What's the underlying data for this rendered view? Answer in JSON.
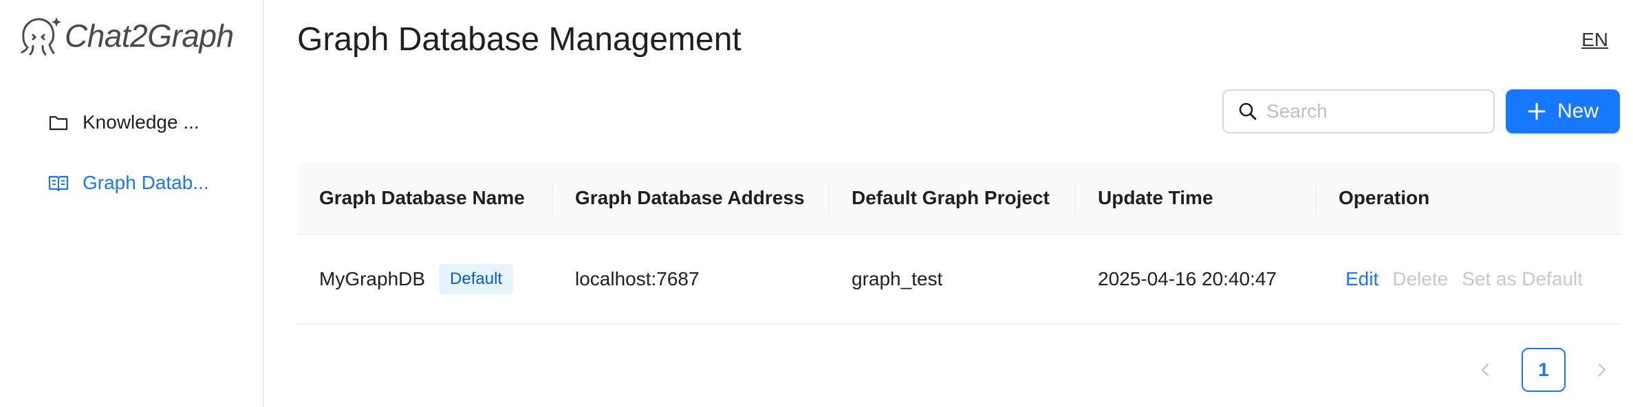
{
  "app": {
    "name": "Chat2Graph",
    "logo_icon": "octopus-logo-icon"
  },
  "sidebar": {
    "items": [
      {
        "label": "Knowledge ...",
        "icon": "folder-icon",
        "active": false
      },
      {
        "label": "Graph Datab...",
        "icon": "book-icon",
        "active": true
      }
    ]
  },
  "header": {
    "title": "Graph Database Management",
    "language": "EN"
  },
  "toolbar": {
    "search_placeholder": "Search",
    "search_value": "",
    "new_label": "New"
  },
  "table": {
    "columns": [
      "Graph Database Name",
      "Graph Database Address",
      "Default Graph Project",
      "Update Time",
      "Operation"
    ],
    "rows": [
      {
        "name": "MyGraphDB",
        "tag": "Default",
        "address": "localhost:7687",
        "project": "graph_test",
        "update_time": "2025-04-16 20:40:47",
        "actions": {
          "edit": "Edit",
          "delete": "Delete",
          "set_default": "Set as Default"
        }
      }
    ]
  },
  "pagination": {
    "current_page": "1"
  },
  "colors": {
    "accent": "#1677ff",
    "disabled": "#c8c8c8",
    "tag_bg": "#e6f4ff"
  }
}
